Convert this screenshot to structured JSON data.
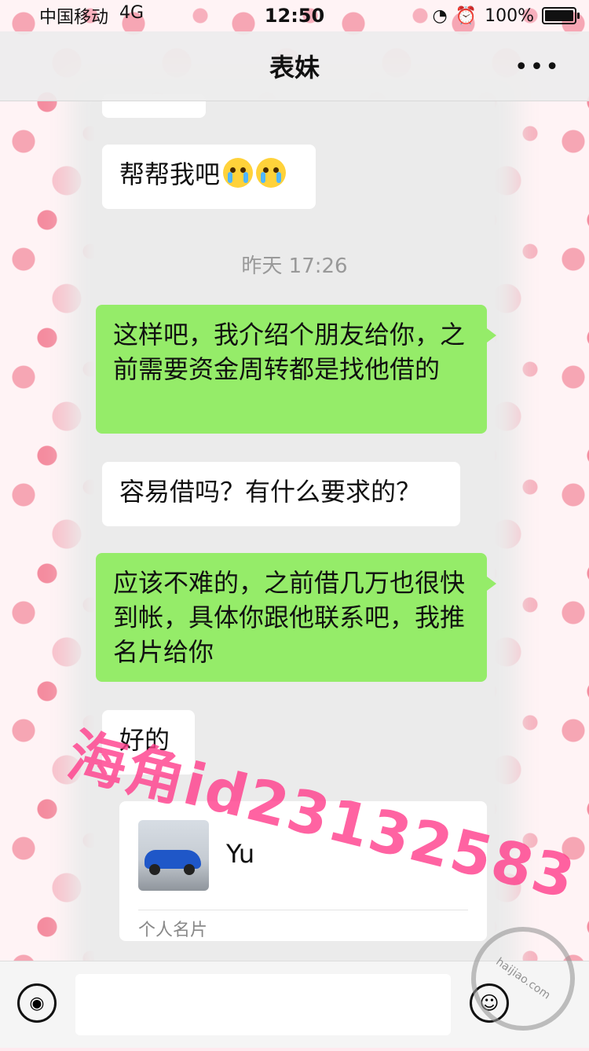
{
  "status_bar": {
    "carrier": "中国移动",
    "network": "4G",
    "time": "12:50",
    "battery": "100%"
  },
  "nav": {
    "title": "表妹",
    "more": "•••"
  },
  "messages": [
    {
      "side": "left",
      "text": "帮帮我吧"
    },
    {
      "side": "right",
      "text": "这样吧，我介绍个朋友给你，之前需要资金周转都是找他借的"
    },
    {
      "side": "left",
      "text": "容易借吗？有什么要求的？"
    },
    {
      "side": "right",
      "text": "应该不难的，之前借几万也很快到帐，具体你跟他联系吧，我推名片给你"
    },
    {
      "side": "left",
      "text": "好的"
    }
  ],
  "timestamp": "昨天 17:26",
  "contact_card": {
    "name": "Yu",
    "label": "个人名片"
  },
  "watermark": "海角id23132583",
  "site_badge": "haijiao.com",
  "icons": {
    "voice": "voice-icon",
    "emoji": "emoji-icon",
    "more": "more-icon"
  }
}
